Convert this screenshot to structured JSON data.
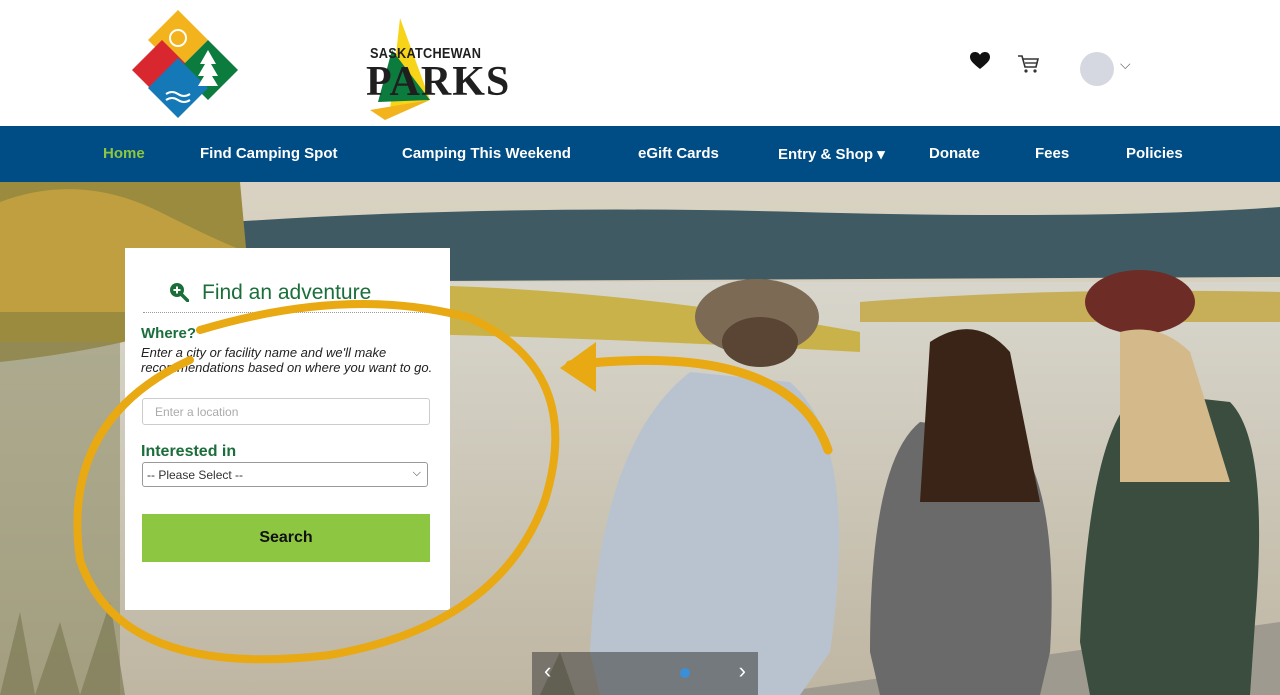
{
  "header": {
    "logo_top_text": "SASKATCHEWAN",
    "logo_main_text": "PARKS",
    "icons": [
      "heart-icon",
      "cart-icon",
      "user-avatar",
      "chevron-down-icon"
    ]
  },
  "nav": {
    "items": [
      {
        "label": "Home",
        "active": true
      },
      {
        "label": "Find Camping Spot"
      },
      {
        "label": "Camping This Weekend"
      },
      {
        "label": "eGift Cards"
      },
      {
        "label": "Entry & Shop"
      },
      {
        "label": "Donate"
      },
      {
        "label": "Fees"
      },
      {
        "label": "Policies"
      }
    ],
    "dropdown_caret": "▾"
  },
  "search": {
    "title": "Find an adventure",
    "where_label": "Where?",
    "where_help": "Enter a city or facility name and we'll make recommendations based on where you want to go.",
    "location_placeholder": "Enter a location",
    "interested_label": "Interested in",
    "select_value": "-- Please Select --",
    "button_label": "Search"
  },
  "carousel": {
    "prev": "‹",
    "next": "›"
  },
  "colors": {
    "nav_bg": "#004c84",
    "active": "#8dc641",
    "title_green": "#1b6e3a",
    "highlight": "#e8a912"
  }
}
